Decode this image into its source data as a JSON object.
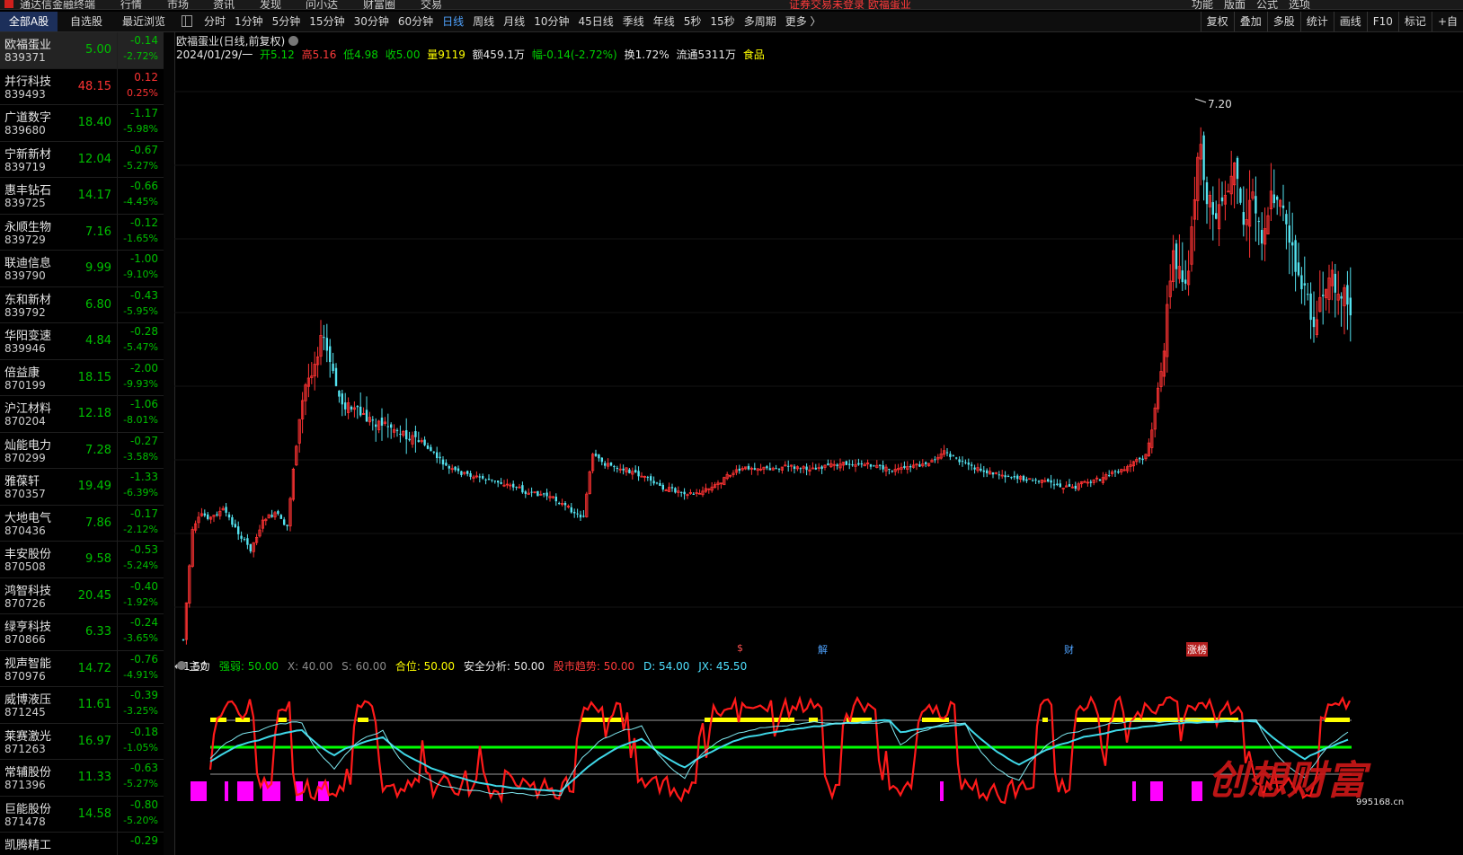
{
  "topbar": {
    "app_title": "通达信金融终端",
    "menus": [
      "行情",
      "市场",
      "资讯",
      "发现",
      "问小达",
      "财富圈",
      "交易"
    ],
    "alert": "证券交易未登录  欧福蛋业",
    "right_menus": [
      "功能",
      "版面",
      "公式",
      "选项"
    ]
  },
  "left_tabs": [
    {
      "label": "全部A股",
      "active": true
    },
    {
      "label": "自选股",
      "active": false
    },
    {
      "label": "最近浏览",
      "active": false
    }
  ],
  "periods": [
    {
      "label": "分时",
      "active": false
    },
    {
      "label": "1分钟",
      "active": false
    },
    {
      "label": "5分钟",
      "active": false
    },
    {
      "label": "15分钟",
      "active": false
    },
    {
      "label": "30分钟",
      "active": false
    },
    {
      "label": "60分钟",
      "active": false
    },
    {
      "label": "日线",
      "active": true
    },
    {
      "label": "周线",
      "active": false
    },
    {
      "label": "月线",
      "active": false
    },
    {
      "label": "10分钟",
      "active": false
    },
    {
      "label": "45日线",
      "active": false
    },
    {
      "label": "季线",
      "active": false
    },
    {
      "label": "年线",
      "active": false
    },
    {
      "label": "5秒",
      "active": false
    },
    {
      "label": "15秒",
      "active": false
    },
    {
      "label": "多周期",
      "active": false
    },
    {
      "label": "更多 〉",
      "active": false
    }
  ],
  "right_tools": [
    "复权",
    "叠加",
    "多股",
    "统计",
    "画线",
    "F10",
    "标记",
    "+自"
  ],
  "stocks": [
    {
      "name": "欧福蛋业",
      "code": "839371",
      "price": "5.00",
      "chg": "-0.14",
      "pct": "-2.72%",
      "dir": "dn",
      "selected": true
    },
    {
      "name": "并行科技",
      "code": "839493",
      "price": "48.15",
      "chg": "0.12",
      "pct": "0.25%",
      "dir": "up"
    },
    {
      "name": "广道数字",
      "code": "839680",
      "price": "18.40",
      "chg": "-1.17",
      "pct": "-5.98%",
      "dir": "dn"
    },
    {
      "name": "宁新新材",
      "code": "839719",
      "price": "12.04",
      "chg": "-0.67",
      "pct": "-5.27%",
      "dir": "dn"
    },
    {
      "name": "惠丰钻石",
      "code": "839725",
      "price": "14.17",
      "chg": "-0.66",
      "pct": "-4.45%",
      "dir": "dn"
    },
    {
      "name": "永顺生物",
      "code": "839729",
      "price": "7.16",
      "chg": "-0.12",
      "pct": "-1.65%",
      "dir": "dn"
    },
    {
      "name": "联迪信息",
      "code": "839790",
      "price": "9.99",
      "chg": "-1.00",
      "pct": "-9.10%",
      "dir": "dn"
    },
    {
      "name": "东和新材",
      "code": "839792",
      "price": "6.80",
      "chg": "-0.43",
      "pct": "-5.95%",
      "dir": "dn"
    },
    {
      "name": "华阳变速",
      "code": "839946",
      "price": "4.84",
      "chg": "-0.28",
      "pct": "-5.47%",
      "dir": "dn"
    },
    {
      "name": "倍益康",
      "code": "870199",
      "price": "18.15",
      "chg": "-2.00",
      "pct": "-9.93%",
      "dir": "dn"
    },
    {
      "name": "沪江材料",
      "code": "870204",
      "price": "12.18",
      "chg": "-1.06",
      "pct": "-8.01%",
      "dir": "dn"
    },
    {
      "name": "灿能电力",
      "code": "870299",
      "price": "7.28",
      "chg": "-0.27",
      "pct": "-3.58%",
      "dir": "dn"
    },
    {
      "name": "雅葆轩",
      "code": "870357",
      "price": "19.49",
      "chg": "-1.33",
      "pct": "-6.39%",
      "dir": "dn"
    },
    {
      "name": "大地电气",
      "code": "870436",
      "price": "7.86",
      "chg": "-0.17",
      "pct": "-2.12%",
      "dir": "dn"
    },
    {
      "name": "丰安股份",
      "code": "870508",
      "price": "9.58",
      "chg": "-0.53",
      "pct": "-5.24%",
      "dir": "dn"
    },
    {
      "name": "鸿智科技",
      "code": "870726",
      "price": "20.45",
      "chg": "-0.40",
      "pct": "-1.92%",
      "dir": "dn"
    },
    {
      "name": "绿亨科技",
      "code": "870866",
      "price": "6.33",
      "chg": "-0.24",
      "pct": "-3.65%",
      "dir": "dn"
    },
    {
      "name": "视声智能",
      "code": "870976",
      "price": "14.72",
      "chg": "-0.76",
      "pct": "-4.91%",
      "dir": "dn"
    },
    {
      "name": "威博液压",
      "code": "871245",
      "price": "11.61",
      "chg": "-0.39",
      "pct": "-3.25%",
      "dir": "dn"
    },
    {
      "name": "莱赛激光",
      "code": "871263",
      "price": "16.97",
      "chg": "-0.18",
      "pct": "-1.05%",
      "dir": "dn"
    },
    {
      "name": "常辅股份",
      "code": "871396",
      "price": "11.33",
      "chg": "-0.63",
      "pct": "-5.27%",
      "dir": "dn"
    },
    {
      "name": "巨能股份",
      "code": "871478",
      "price": "14.58",
      "chg": "-0.80",
      "pct": "-5.20%",
      "dir": "dn"
    },
    {
      "name": "凯腾精工",
      "code": "",
      "price": "",
      "chg": "-0.29",
      "pct": "",
      "dir": "dn"
    }
  ],
  "chart_header": {
    "title": "欧福蛋业(日线,前复权)",
    "date": "2024/01/29/一",
    "open": "开5.12",
    "high": "高5.16",
    "low": "低4.98",
    "close": "收5.00",
    "volume": "量9119",
    "amount": "额459.1万",
    "range": "幅-0.14(-2.72%)",
    "turnover": "换1.72%",
    "float": "流通5311万",
    "sector": "食品"
  },
  "chart_labels": {
    "max_label": "7.20",
    "min_label": "←1.50",
    "events": [
      "$",
      "解",
      "财",
      "涨榜"
    ]
  },
  "indicator": {
    "name": "主力",
    "qiangruo": "强弱: 50.00",
    "x": "X: 40.00",
    "s": "S: 60.00",
    "hewei": "合位: 50.00",
    "anquan": "安全分析: 50.00",
    "qushi": "股市趋势: 50.00",
    "d": "D: 54.00",
    "jx": "JX: 45.50"
  },
  "watermark": {
    "text": "创想财富",
    "url": "995168.cn"
  },
  "colors": {
    "up": "#ff3333",
    "down": "#54e3f0",
    "accent": "#4fa3ff",
    "yellow": "#ffff00",
    "green": "#00ff00",
    "magenta": "#ff00ff"
  }
}
